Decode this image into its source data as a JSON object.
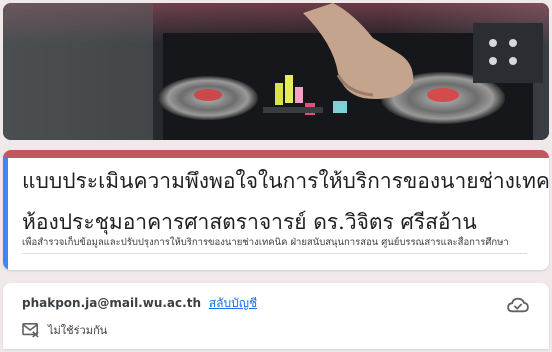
{
  "theme": {
    "accent": "#c0575e",
    "card_bg": "#ffffff",
    "page_bg": "#f0e8e9",
    "left_strip": "#4285f4",
    "link": "#1a73e8"
  },
  "banner": {
    "image": "dj-turntable-mixer-photo"
  },
  "form": {
    "title_line1": "แบบประเมินความพึงพอใจในการให้บริการของนายช่างเทคนิค",
    "title_line2": "ห้องประชุมอาคารศาสตราจารย์ ดร.วิจิตร ศรีสอ้าน",
    "description": "เพื่อสำรวจเก็บข้อมูลและปรับปรุงการให้บริการของนายช่างเทคนิค ฝ่ายสนับสนุนการสอน ศูนย์บรรณสารและสื่อการศึกษา"
  },
  "account": {
    "email": "phakpon.ja@mail.wu.ac.th",
    "switch_label": "สลับบัญชี",
    "status_icon": "cloud-saved-icon",
    "not_shared_icon": "mail-off-icon",
    "not_shared_label": "ไม่ใช้ร่วมกัน"
  }
}
